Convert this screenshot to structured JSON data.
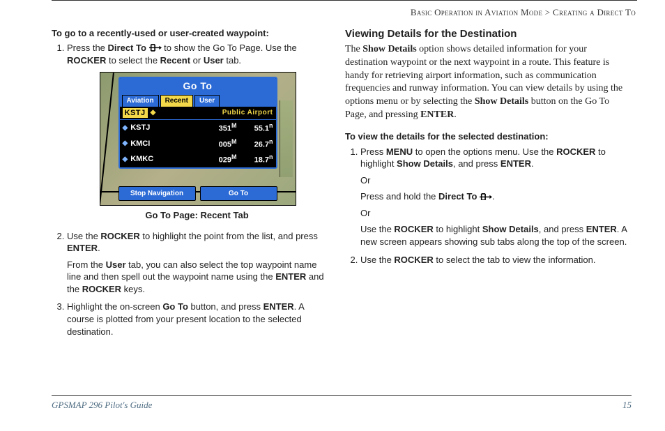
{
  "breadcrumb": {
    "a": "Basic Operation in Aviation Mode",
    "sep": " > ",
    "b": "Creating a Direct To"
  },
  "left": {
    "task_title": "To go to a recently-used or user-created waypoint:",
    "step1_a": "Press the ",
    "step1_b": "Direct To",
    "step1_c": " to show the Go To Page. Use the ",
    "step1_d": "ROCKER",
    "step1_e": " to select the ",
    "step1_f": "Recent",
    "step1_g": " or ",
    "step1_h": "User",
    "step1_i": " tab.",
    "caption": "Go To Page: Recent Tab",
    "step2_a": "Use the ",
    "step2_b": "ROCKER",
    "step2_c": " to highlight the point from the list, and press ",
    "step2_d": "ENTER",
    "step2_e": ".",
    "step2f_a": "From the ",
    "step2f_b": "User",
    "step2f_c": " tab, you can also select the top waypoint name line and then spell out the waypoint name using the ",
    "step2f_d": "ENTER",
    "step2f_e": " and the ",
    "step2f_f": "ROCKER",
    "step2f_g": " keys.",
    "step3_a": "Highlight the on-screen ",
    "step3_b": "Go To",
    "step3_c": " button, and press ",
    "step3_d": "ENTER",
    "step3_e": ". A course is plotted from your present location to the selected destination."
  },
  "right": {
    "heading": "Viewing Details for the Destination",
    "para_a": "The ",
    "para_b": "Show Details",
    "para_c": " option shows detailed information for your destination waypoint or the next waypoint in a route. This feature is handy for retrieving airport information, such as communication frequencies and runway information. You can view details by using the options menu or by selecting the ",
    "para_d": "Show Details",
    "para_e": " button on the Go To Page, and pressing ",
    "para_f": "ENTER",
    "para_g": ".",
    "task_title": "To view the details for the selected destination:",
    "s1_a": "Press ",
    "s1_b": "MENU",
    "s1_c": " to open the options menu. Use the ",
    "s1_d": "ROCKER",
    "s1_e": " to highlight ",
    "s1_f": "Show Details",
    "s1_g": ", and press ",
    "s1_h": "ENTER",
    "s1_i": ".",
    "s1_or1": "Or",
    "s1_j": "Press and hold the ",
    "s1_k": "Direct To",
    "s1_l": ".",
    "s1_or2": "Or",
    "s1_m": "Use the ",
    "s1_n": "ROCKER",
    "s1_o": " to highlight ",
    "s1_p": "Show Details",
    "s1_q": ", and press ",
    "s1_r": "ENTER",
    "s1_s": ". A new screen appears showing sub tabs along the top of the screen.",
    "s2_a": "Use the ",
    "s2_b": "ROCKER",
    "s2_c": " to select the tab to view the information."
  },
  "gps": {
    "title": "Go To",
    "tabs": [
      "Aviation",
      "Recent",
      "User"
    ],
    "active_tab": 1,
    "ident": "KSTJ",
    "ident_type": "Public Airport",
    "rows": [
      {
        "id": "KSTJ",
        "brg": "351",
        "dist": "55.1"
      },
      {
        "id": "KMCI",
        "brg": "005",
        "dist": "26.7"
      },
      {
        "id": "KMKC",
        "brg": "029",
        "dist": "18.7"
      }
    ],
    "btn_left": "Stop Navigation",
    "btn_right": "Go To"
  },
  "footer": {
    "left": "GPSMAP 296 Pilot's Guide",
    "right": "15"
  }
}
